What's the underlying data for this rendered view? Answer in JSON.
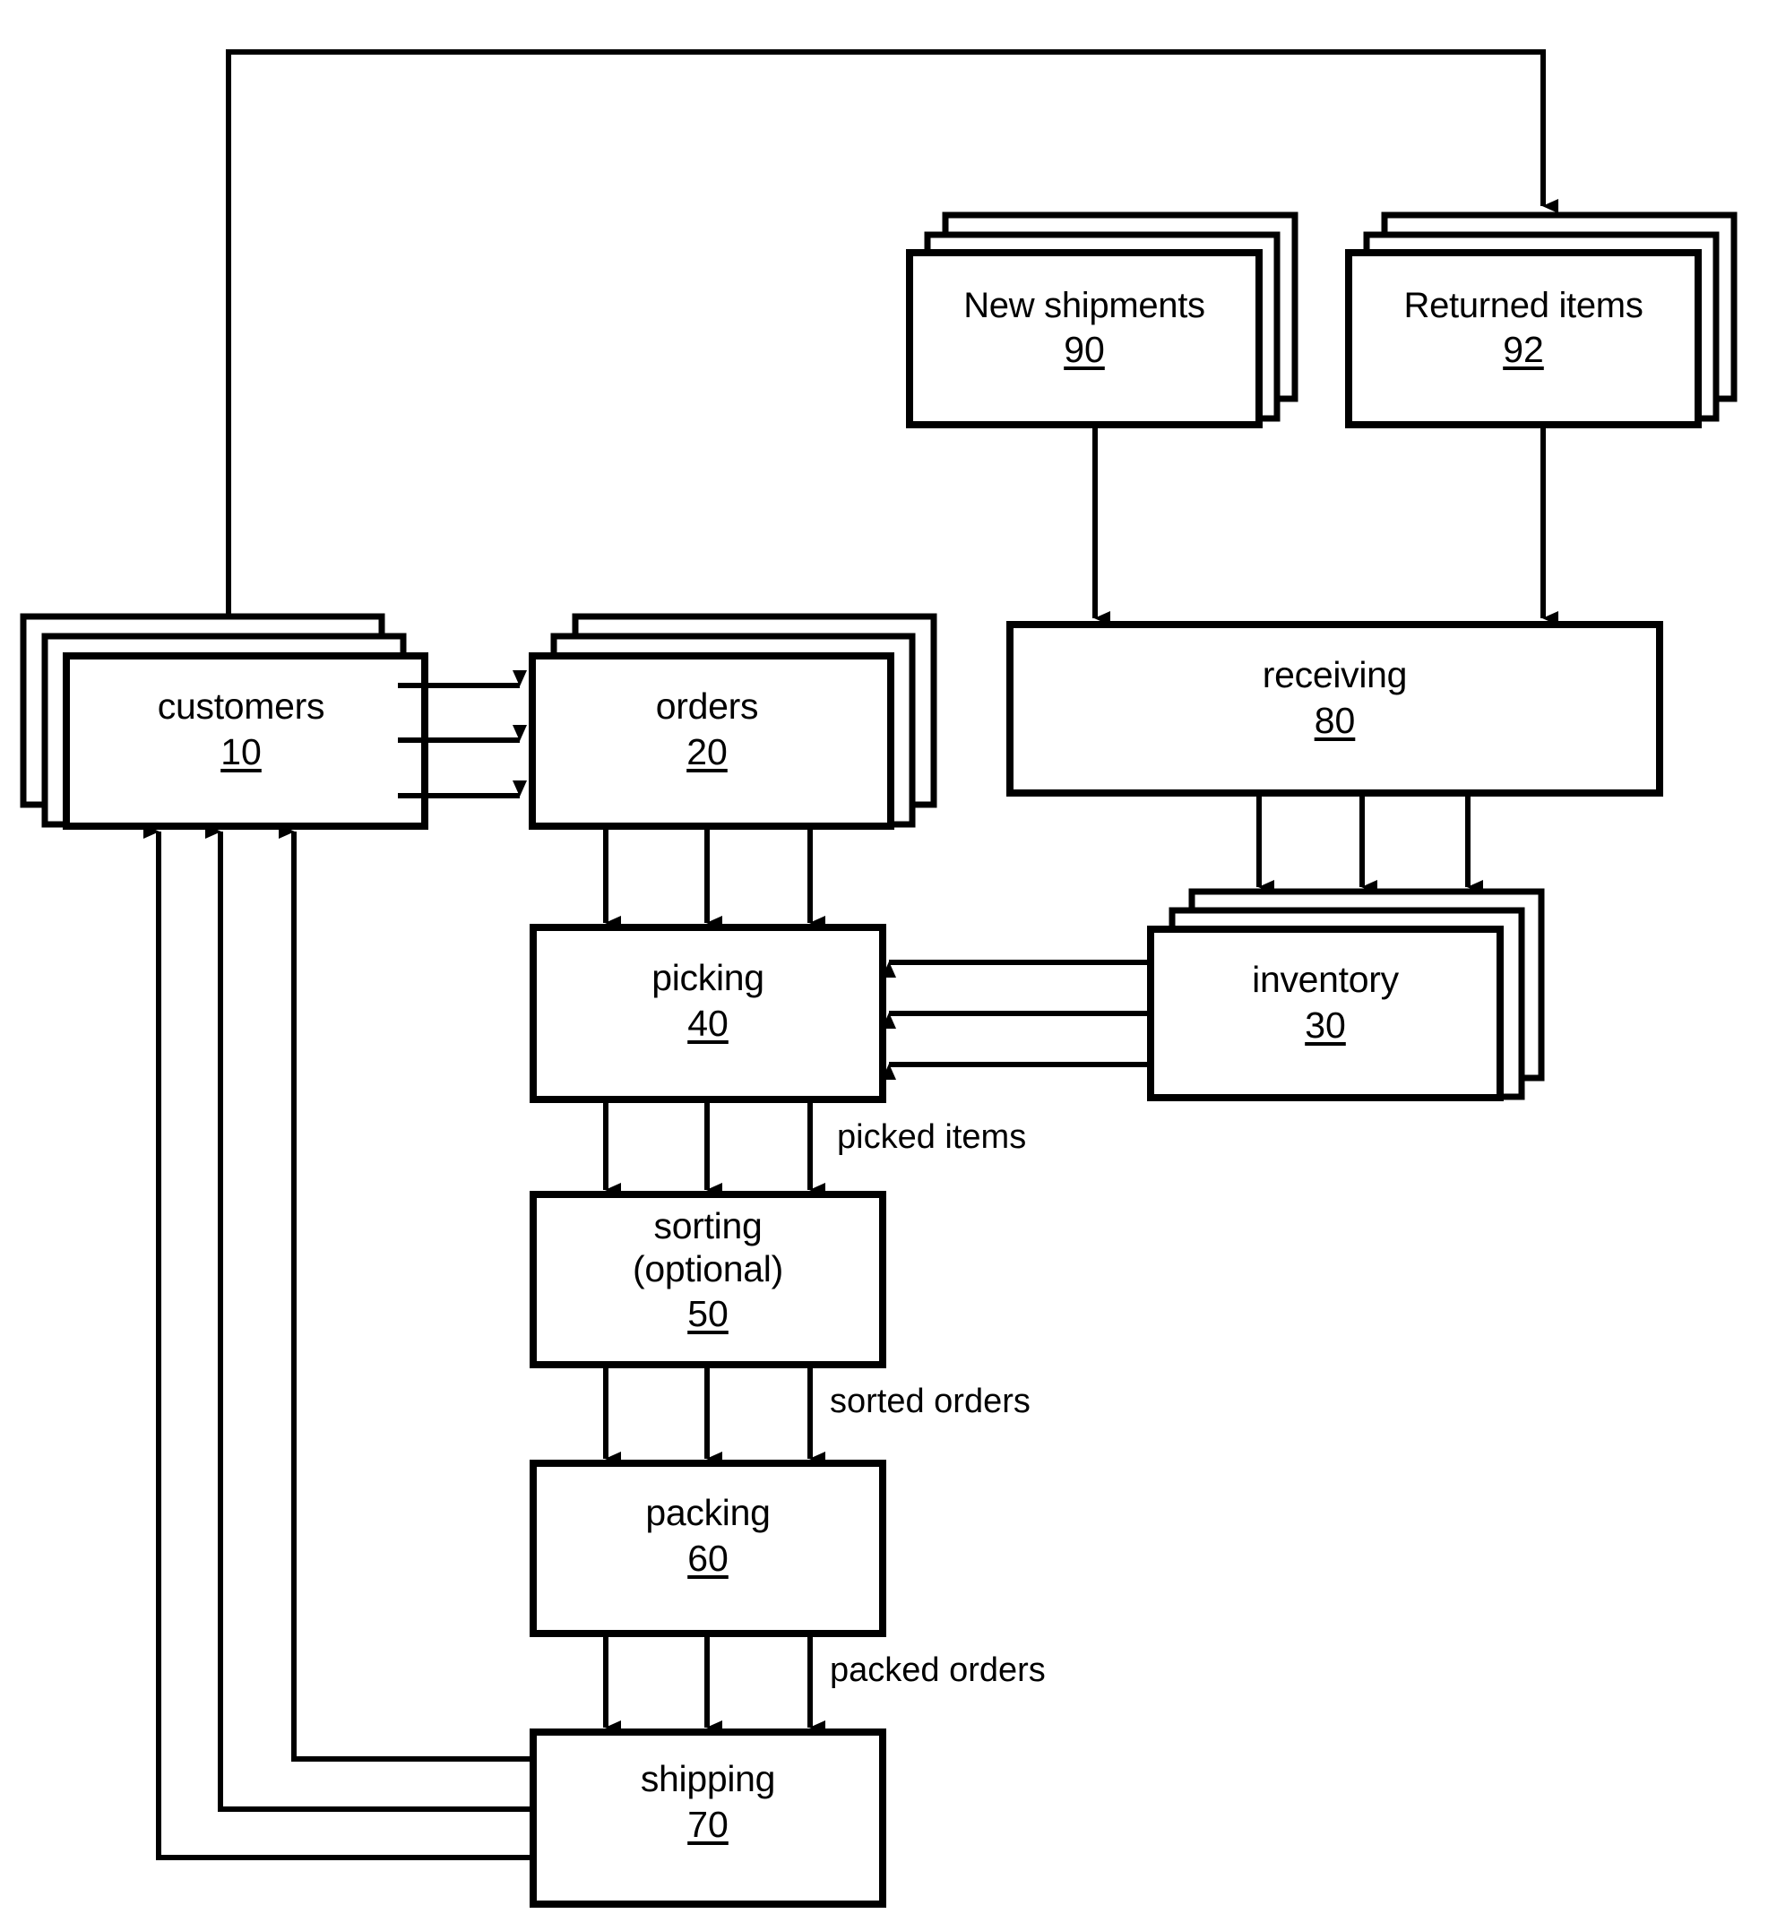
{
  "figure": {
    "type": "patent-flow-diagram",
    "title": "Order fulfillment process flow diagram",
    "background_color": "#ffffff",
    "line_color": "#000000"
  },
  "nodes": [
    {
      "id": "customers",
      "name": "customers",
      "ref": "10",
      "shape": "stacked-card",
      "stack_direction": "up-left",
      "stack_count": 3
    },
    {
      "id": "orders",
      "name": "orders",
      "ref": "20",
      "shape": "stacked-card",
      "stack_direction": "up-right",
      "stack_count": 3
    },
    {
      "id": "inventory",
      "name": "inventory",
      "ref": "30",
      "shape": "stacked-card",
      "stack_direction": "up-right",
      "stack_count": 3
    },
    {
      "id": "picking",
      "name": "picking",
      "ref": "40",
      "shape": "rectangle",
      "stack_count": 1
    },
    {
      "id": "sorting",
      "name": "sorting",
      "name_line2": "(optional)",
      "ref": "50",
      "shape": "rectangle",
      "stack_count": 1
    },
    {
      "id": "packing",
      "name": "packing",
      "ref": "60",
      "shape": "rectangle",
      "stack_count": 1
    },
    {
      "id": "shipping",
      "name": "shipping",
      "ref": "70",
      "shape": "rectangle",
      "stack_count": 1
    },
    {
      "id": "receiving",
      "name": "receiving",
      "ref": "80",
      "shape": "rectangle",
      "stack_count": 1
    },
    {
      "id": "new_shipments",
      "name": "New shipments",
      "ref": "90",
      "shape": "stacked-card",
      "stack_direction": "up-right",
      "stack_count": 3
    },
    {
      "id": "returned_items",
      "name": "Returned items",
      "ref": "92",
      "shape": "stacked-card",
      "stack_direction": "up-right",
      "stack_count": 3
    }
  ],
  "edge_labels": [
    {
      "id": "picked_items",
      "text": "picked items"
    },
    {
      "id": "sorted_orders",
      "text": "sorted orders"
    },
    {
      "id": "packed_orders",
      "text": "packed orders"
    }
  ],
  "edges": [
    {
      "from": "customers",
      "to": "orders",
      "count": 3,
      "direction": "right"
    },
    {
      "from": "orders",
      "to": "picking",
      "count": 3,
      "direction": "down"
    },
    {
      "from": "inventory",
      "to": "picking",
      "count": 3,
      "direction": "left"
    },
    {
      "from": "picking",
      "to": "sorting",
      "count": 3,
      "direction": "down",
      "label": "picked items"
    },
    {
      "from": "sorting",
      "to": "packing",
      "count": 3,
      "direction": "down",
      "label": "sorted orders"
    },
    {
      "from": "packing",
      "to": "shipping",
      "count": 3,
      "direction": "down",
      "label": "packed orders"
    },
    {
      "from": "shipping",
      "to": "customers",
      "count": 3,
      "direction": "left-then-up"
    },
    {
      "from": "customers",
      "to": "returned_items",
      "count": 1,
      "direction": "up-then-right-then-down"
    },
    {
      "from": "new_shipments",
      "to": "receiving",
      "count": 1,
      "direction": "down"
    },
    {
      "from": "returned_items",
      "to": "receiving",
      "count": 1,
      "direction": "down"
    },
    {
      "from": "receiving",
      "to": "inventory",
      "count": 3,
      "direction": "down"
    }
  ]
}
